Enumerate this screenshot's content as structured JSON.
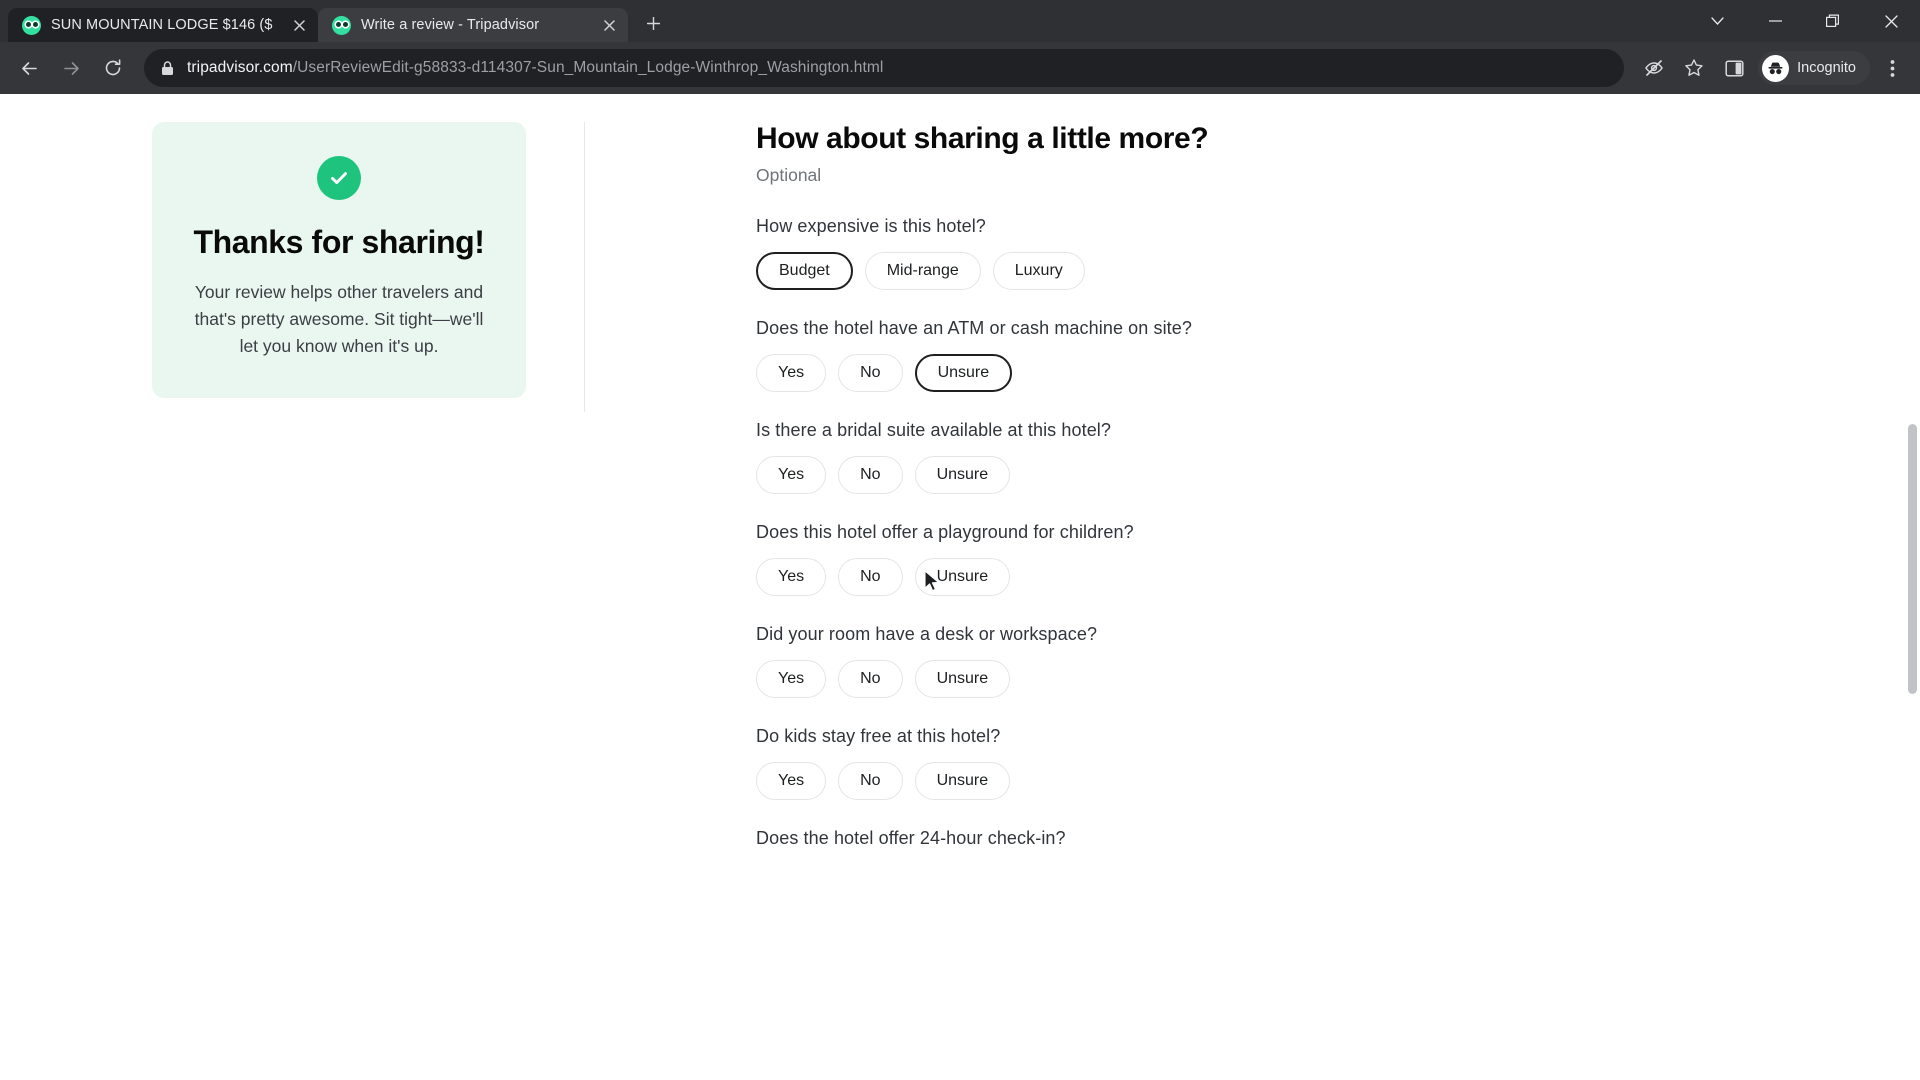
{
  "window": {
    "controls": [
      {
        "name": "tab-search",
        "icon": "chevron-down-icon"
      },
      {
        "name": "minimize",
        "icon": "minimize-icon"
      },
      {
        "name": "maximize",
        "icon": "restore-icon"
      },
      {
        "name": "close",
        "icon": "close-icon"
      }
    ]
  },
  "tabs": [
    {
      "title": "SUN MOUNTAIN LODGE $146 ($",
      "favicon": "tripadvisor-owl-icon",
      "active": false
    },
    {
      "title": "Write a review - Tripadvisor",
      "favicon": "tripadvisor-owl-icon",
      "active": true
    }
  ],
  "new_tab_label": "+",
  "toolbar": {
    "back_icon": "back-arrow-icon",
    "forward_icon": "forward-arrow-icon",
    "reload_icon": "reload-icon",
    "lock_icon": "lock-icon",
    "url_domain": "tripadvisor.com",
    "url_path": "/UserReviewEdit-g58833-d114307-Sun_Mountain_Lodge-Winthrop_Washington.html",
    "third_party_cookie_icon": "eye-slash-icon",
    "bookmark_icon": "star-icon",
    "side_panel_icon": "side-panel-icon",
    "incognito_label": "Incognito",
    "incognito_icon": "incognito-hat-icon",
    "menu_icon": "three-dot-menu-icon"
  },
  "confirmation": {
    "check_icon": "check-circle-icon",
    "title": "Thanks for sharing!",
    "body": "Your review helps other travelers and that's pretty awesome. Sit tight—we'll let you know when it's up.",
    "background": "#eaf7f1",
    "accent": "#1ec47e"
  },
  "form": {
    "title": "How about sharing a little more?",
    "subtitle": "Optional",
    "questions": [
      {
        "label": "How expensive is this hotel?",
        "options": [
          {
            "label": "Budget",
            "selected": true
          },
          {
            "label": "Mid-range",
            "selected": false
          },
          {
            "label": "Luxury",
            "selected": false
          }
        ]
      },
      {
        "label": "Does the hotel have an ATM or cash machine on site?",
        "options": [
          {
            "label": "Yes",
            "selected": false
          },
          {
            "label": "No",
            "selected": false
          },
          {
            "label": "Unsure",
            "selected": true
          }
        ]
      },
      {
        "label": "Is there a bridal suite available at this hotel?",
        "options": [
          {
            "label": "Yes",
            "selected": false
          },
          {
            "label": "No",
            "selected": false
          },
          {
            "label": "Unsure",
            "selected": false
          }
        ]
      },
      {
        "label": "Does this hotel offer a playground for children?",
        "options": [
          {
            "label": "Yes",
            "selected": false
          },
          {
            "label": "No",
            "selected": false
          },
          {
            "label": "Unsure",
            "selected": false
          }
        ]
      },
      {
        "label": "Did your room have a desk or workspace?",
        "options": [
          {
            "label": "Yes",
            "selected": false
          },
          {
            "label": "No",
            "selected": false
          },
          {
            "label": "Unsure",
            "selected": false
          }
        ]
      },
      {
        "label": "Do kids stay free at this hotel?",
        "options": [
          {
            "label": "Yes",
            "selected": false
          },
          {
            "label": "No",
            "selected": false
          },
          {
            "label": "Unsure",
            "selected": false
          }
        ]
      },
      {
        "label": "Does the hotel offer 24-hour check-in?",
        "options": []
      }
    ]
  }
}
